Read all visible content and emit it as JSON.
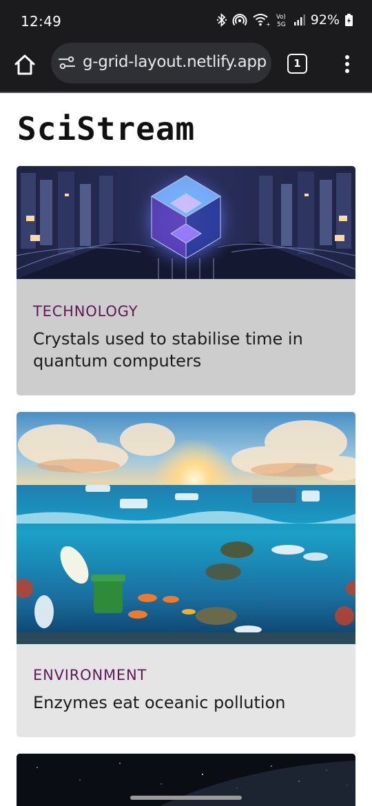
{
  "status_bar": {
    "time": "12:49",
    "battery": "92%",
    "icons": [
      "bluetooth-icon",
      "hotspot-icon",
      "wifi-icon",
      "volte-5g-icon",
      "signal-icon",
      "battery-icon"
    ]
  },
  "browser": {
    "url": "g-grid-layout.netlify.app",
    "tab_count": "1",
    "icons": [
      "home-icon",
      "site-info-icon",
      "more-vert-icon"
    ]
  },
  "site": {
    "title": "SciStream"
  },
  "cards": [
    {
      "category": "TECHNOLOGY",
      "headline": "Crystals used to stabilise time in quantum computers",
      "image": "quantum-crystal-image"
    },
    {
      "category": "ENVIRONMENT",
      "headline": "Enzymes eat oceanic pollution",
      "image": "ocean-pollution-image"
    },
    {
      "category": "",
      "headline": "",
      "image": "space-image"
    }
  ],
  "colors": {
    "category": "#5c1a52",
    "browser_bar": "#1b1b1d",
    "card_1_bg": "#cdcdcd",
    "card_2_bg": "#e5e5e5"
  }
}
